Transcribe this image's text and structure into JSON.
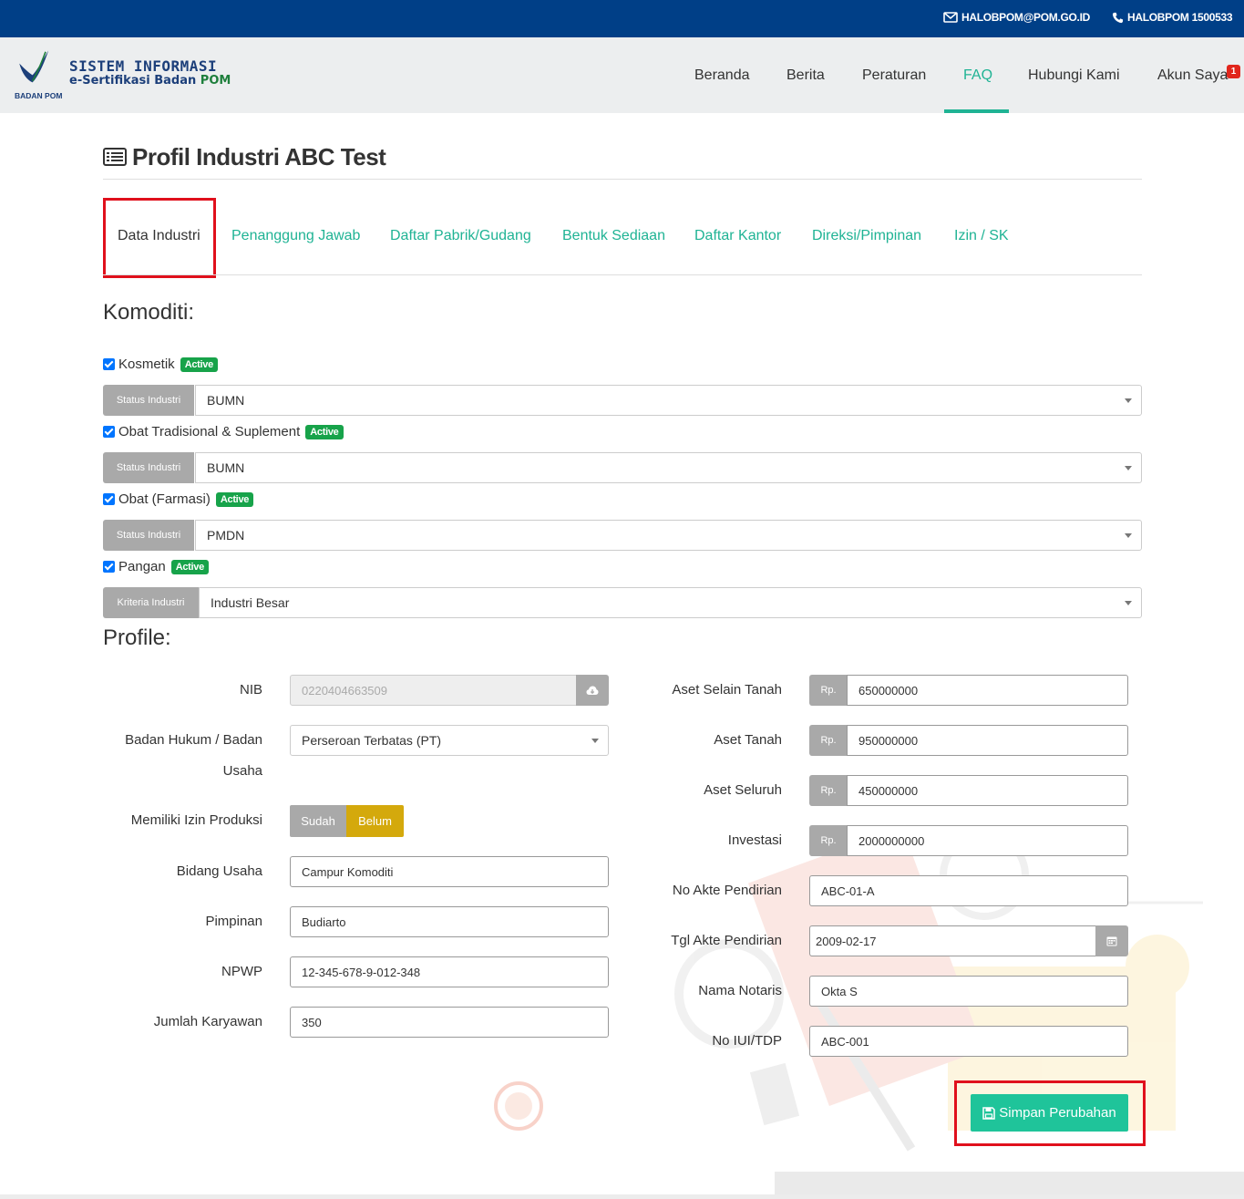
{
  "topbar": {
    "email": "HALOBPOM@POM.GO.ID",
    "phone": "HALOBPOM 1500533"
  },
  "brand": {
    "line1": "SISTEM INFORMASI",
    "line2_prefix": "e-Sertifikasi Badan ",
    "line2_suffix": "POM",
    "logo_caption": "BADAN POM"
  },
  "nav": {
    "items": [
      "Beranda",
      "Berita",
      "Peraturan",
      "FAQ",
      "Hubungi Kami",
      "Akun Saya"
    ],
    "active": "FAQ",
    "account_badge": "1"
  },
  "page": {
    "title": "Profil Industri ABC Test"
  },
  "tabs": [
    "Data Industri",
    "Penanggung Jawab",
    "Daftar Pabrik/Gudang",
    "Bentuk Sediaan",
    "Daftar Kantor",
    "Direksi/Pimpinan",
    "Izin / SK"
  ],
  "komoditi": {
    "heading": "Komoditi:",
    "items": [
      {
        "name": "Kosmetik",
        "badge": "Active",
        "addon": "Status Industri",
        "value": "BUMN"
      },
      {
        "name": "Obat Tradisional & Suplement",
        "badge": "Active",
        "addon": "Status Industri",
        "value": "BUMN"
      },
      {
        "name": "Obat (Farmasi)",
        "badge": "Active",
        "addon": "Status Industri",
        "value": "PMDN"
      },
      {
        "name": "Pangan",
        "badge": "Active",
        "addon": "Kriteria Industri",
        "value": "Industri Besar"
      }
    ]
  },
  "profile": {
    "heading": "Profile:",
    "left": {
      "nib_label": "NIB",
      "nib_value": "0220404663509",
      "badan_hukum_label_1": "Badan Hukum / Badan",
      "badan_hukum_label_2": "Usaha",
      "badan_hukum_value": "Perseroan Terbatas (PT)",
      "izin_label": "Memiliki Izin Produksi",
      "izin_yes": "Sudah",
      "izin_no": "Belum",
      "bidang_label": "Bidang Usaha",
      "bidang_value": "Campur Komoditi",
      "pimpinan_label": "Pimpinan",
      "pimpinan_value": "Budiarto",
      "npwp_label": "NPWP",
      "npwp_value": "12-345-678-9-012-348",
      "karyawan_label": "Jumlah Karyawan",
      "karyawan_value": "350"
    },
    "right": {
      "currency": "Rp.",
      "aset_selain_label": "Aset Selain Tanah",
      "aset_selain_value": "650000000",
      "aset_tanah_label": "Aset Tanah",
      "aset_tanah_value": "950000000",
      "aset_seluruh_label": "Aset Seluruh",
      "aset_seluruh_value": "450000000",
      "investasi_label": "Investasi",
      "investasi_value": "2000000000",
      "akte_label": "No Akte Pendirian",
      "akte_value": "ABC-01-A",
      "tgl_akte_label": "Tgl Akte Pendirian",
      "tgl_akte_value": "2009-02-17",
      "notaris_label": "Nama Notaris",
      "notaris_value": "Okta S",
      "iui_label": "No IUI/TDP",
      "iui_value": "ABC-001"
    }
  },
  "actions": {
    "save_label": "Simpan Perubahan"
  },
  "colors": {
    "topbar": "#003f87",
    "accent": "#1fb394",
    "highlight_box": "#e0101c",
    "active_badge": "#17a34a",
    "belum_button": "#d4a90c"
  }
}
